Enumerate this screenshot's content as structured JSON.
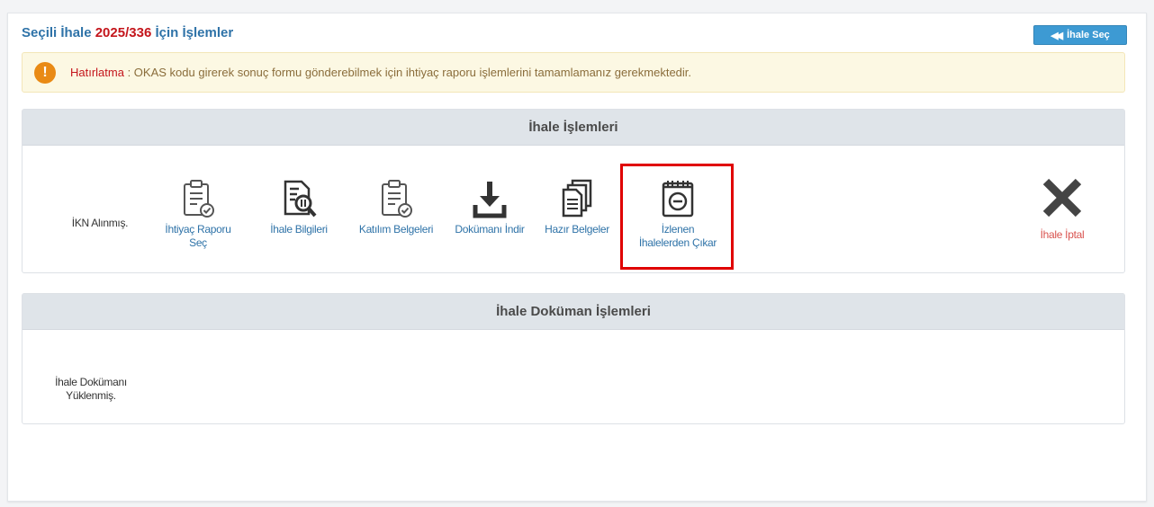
{
  "header": {
    "title_prefix": "Seçili İhale ",
    "ihale_no": "2025/336",
    "title_suffix": " İçin İşlemler",
    "select_button": "İhale Seç"
  },
  "alert": {
    "label": "Hatırlatma",
    "message": " : OKAS kodu girerek sonuç formu gönderebilmek için ihtiyaç raporu işlemlerini tamamlamanız gerekmektedir."
  },
  "panels": {
    "ihale_islemleri": {
      "title": "İhale İşlemleri",
      "status": "İKN Alınmış.",
      "actions": [
        {
          "label": "İhtiyaç Raporu Seç",
          "icon": "document-check-icon"
        },
        {
          "label": "İhale Bilgileri",
          "icon": "document-search-icon"
        },
        {
          "label": "Katılım Belgeleri",
          "icon": "document-check-icon"
        },
        {
          "label": "Dokümanı İndir",
          "icon": "download-icon"
        },
        {
          "label": "Hazır Belgeler",
          "icon": "documents-stack-icon"
        },
        {
          "label": "İzlenen İhalelerden Çıkar",
          "icon": "notepad-minus-icon"
        },
        {
          "label": "İhale İptal",
          "icon": "cross-icon"
        }
      ]
    },
    "dokuman_islemleri": {
      "title": "İhale Doküman İşlemleri",
      "status": "İhale Dokümanı Yüklenmiş."
    }
  },
  "colors": {
    "link": "#2f73a8",
    "ihale_no": "#c4161c",
    "danger": "#d9534f",
    "alert_bg": "#fcf8e3",
    "button": "#3d9ad3",
    "highlight": "#e00000"
  }
}
